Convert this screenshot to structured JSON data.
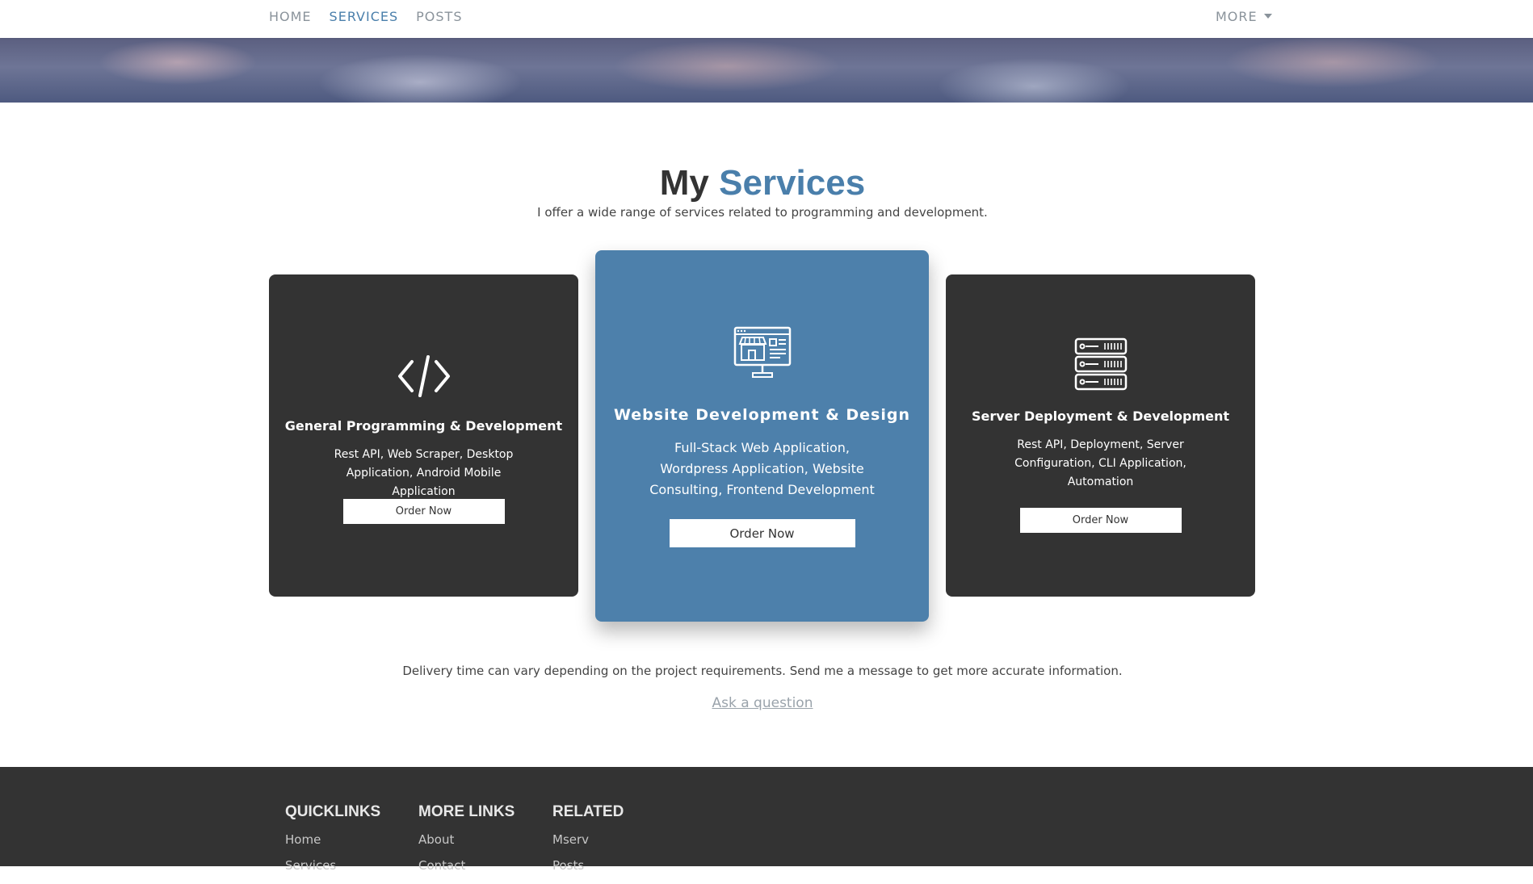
{
  "nav": {
    "links": [
      {
        "label": "HOME",
        "active": false
      },
      {
        "label": "SERVICES",
        "active": true
      },
      {
        "label": "POSTS",
        "active": false
      }
    ],
    "more_label": "MORE"
  },
  "section": {
    "title_plain": "My ",
    "title_accent": "Services",
    "subtitle": "I offer a wide range of services related to programming and development."
  },
  "cards": [
    {
      "icon": "code-icon",
      "title": "General Programming & Development",
      "description": "Rest API, Web Scraper, Desktop Application, Android Mobile Application",
      "button": "Order Now"
    },
    {
      "icon": "storefront-monitor-icon",
      "title": "Website Development & Design",
      "description": "Full-Stack Web Application, Wordpress Application, Website Consulting, Frontend Development",
      "button": "Order Now"
    },
    {
      "icon": "server-icon",
      "title": "Server Deployment & Development",
      "description": "Rest API, Deployment, Server Configuration, CLI Application, Automation",
      "button": "Order Now"
    }
  ],
  "note": "Delivery time can vary depending on the project requirements. Send me a message to get more accurate information.",
  "ask_link": "Ask a question",
  "footer": {
    "columns": [
      {
        "heading": "QUICKLINKS",
        "links": [
          "Home",
          "Services"
        ]
      },
      {
        "heading": "MORE LINKS",
        "links": [
          "About",
          "Contact"
        ]
      },
      {
        "heading": "RELATED",
        "links": [
          "Mserv",
          "Posts"
        ]
      }
    ]
  },
  "colors": {
    "accent": "#4a7fab",
    "card_dark": "#333333",
    "card_blue": "#4d80ab",
    "footer_bg": "#333333"
  }
}
